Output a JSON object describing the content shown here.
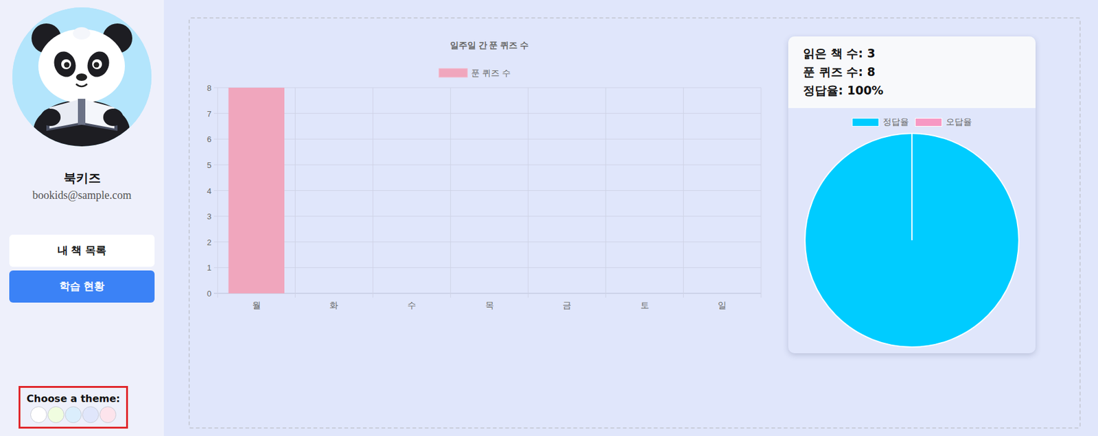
{
  "user": {
    "name": "북키즈",
    "email": "bookids@sample.com"
  },
  "nav": [
    {
      "label": "내 책 목록",
      "selected": false
    },
    {
      "label": "학습 현황",
      "selected": true
    }
  ],
  "theme": {
    "label": "Choose a theme:",
    "swatches": [
      {
        "color": "#ffffff"
      },
      {
        "color": "#f0fde0"
      },
      {
        "color": "#dbeefc"
      },
      {
        "color": "#e0e6fb"
      },
      {
        "color": "#fde4ec"
      }
    ]
  },
  "chart": {
    "title": "일주일 간 푼 퀴즈 수",
    "legend": "푼 퀴즈 수",
    "y_ticks": [
      "0",
      "1",
      "2",
      "3",
      "4",
      "5",
      "6",
      "7",
      "8"
    ],
    "x_labels": [
      "월",
      "화",
      "수",
      "목",
      "금",
      "토",
      "일"
    ],
    "values": [
      8,
      0,
      0,
      0,
      0,
      0,
      0
    ]
  },
  "stats": {
    "lines": [
      "읽은 책 수: 3",
      "푼 퀴즈 수: 8",
      "정답율: 100%"
    ],
    "legend": [
      {
        "label": "정답율",
        "color": "#00ccff"
      },
      {
        "label": "오답율",
        "color": "#f799c4"
      }
    ],
    "values": [
      100,
      0
    ]
  }
}
